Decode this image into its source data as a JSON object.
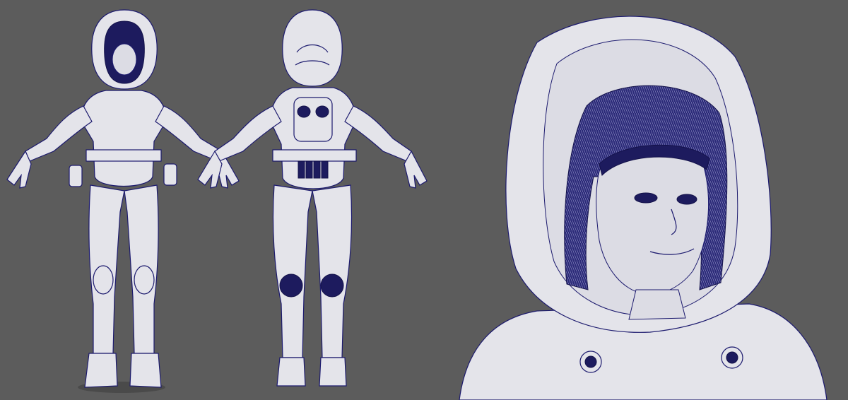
{
  "scene": {
    "background_color": "#5c5c5c",
    "wire_color": "#1c1a6e",
    "surface_color": "#e4e4ea",
    "panels": [
      "front-view",
      "back-view",
      "closeup-view"
    ]
  }
}
